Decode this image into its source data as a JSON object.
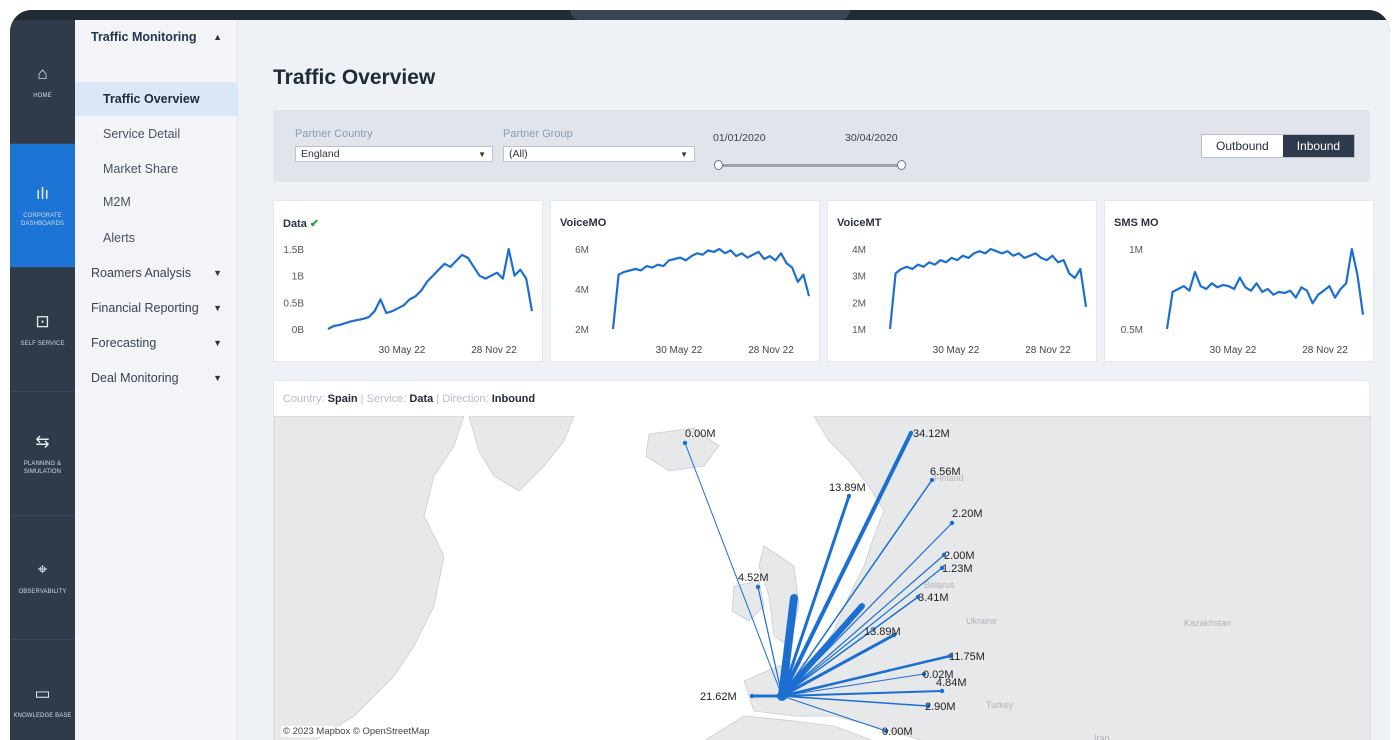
{
  "rail": [
    {
      "label": "HOME",
      "icon": "home-icon",
      "glyph": "⌂",
      "active": false
    },
    {
      "label": "CORPORATE DASHBOARDS",
      "icon": "bar-chart-icon",
      "glyph": "ılı",
      "active": true
    },
    {
      "label": "SELF SERVICE",
      "icon": "folder-icon",
      "glyph": "⊡",
      "active": false
    },
    {
      "label": "PLANNING & SIMULATION",
      "icon": "route-icon",
      "glyph": "⇆",
      "active": false
    },
    {
      "label": "OBSERVABILITY",
      "icon": "telescope-icon",
      "glyph": "⌖",
      "active": false
    },
    {
      "label": "KNOWLEDGE BASE",
      "icon": "book-icon",
      "glyph": "▭",
      "active": false
    }
  ],
  "nav": {
    "group_open": "Traffic Monitoring",
    "sub_items": [
      "Traffic Overview",
      "Service Detail",
      "Market Share",
      "M2M",
      "Alerts"
    ],
    "active_sub": "Traffic Overview",
    "groups": [
      "Roamers Analysis",
      "Financial Reporting",
      "Forecasting",
      "Deal Monitoring"
    ]
  },
  "page_title": "Traffic Overview",
  "filters": {
    "partner_country_label": "Partner Country",
    "partner_country_value": "England",
    "partner_group_label": "Partner Group",
    "partner_group_value": "(All)",
    "date_start": "01/01/2020",
    "date_end": "30/04/2020"
  },
  "direction": {
    "outbound": "Outbound",
    "inbound": "Inbound",
    "selected": "Inbound"
  },
  "check_mark": "✔",
  "accent": "#1c6fd0",
  "cards": [
    {
      "title": "Data",
      "yticks": [
        "1.5B",
        "1B",
        "0.5B",
        "0B"
      ],
      "xticks": [
        "30 May 22",
        "28 Nov 22"
      ],
      "values": [
        0.05,
        0.1,
        0.12,
        0.15,
        0.18,
        0.2,
        0.22,
        0.25,
        0.35,
        0.55,
        0.32,
        0.35,
        0.4,
        0.45,
        0.55,
        0.6,
        0.7,
        0.85,
        0.95,
        1.05,
        1.15,
        1.1,
        1.2,
        1.3,
        1.25,
        1.1,
        0.95,
        0.9,
        0.95,
        1.0,
        0.9,
        1.4,
        0.95,
        1.05,
        0.9,
        0.35
      ],
      "check": true
    },
    {
      "title": "VoiceMO",
      "yticks": [
        "6M",
        "4M",
        "2M"
      ],
      "xticks": [
        "30 May 22",
        "28 Nov 22"
      ],
      "values": [
        1.2,
        5.0,
        5.2,
        5.3,
        5.4,
        5.3,
        5.6,
        5.5,
        5.7,
        5.6,
        6.0,
        6.1,
        6.2,
        6.0,
        6.3,
        6.5,
        6.4,
        6.7,
        6.6,
        6.8,
        6.5,
        6.7,
        6.3,
        6.5,
        6.2,
        6.4,
        6.6,
        6.1,
        6.3,
        6.0,
        6.5,
        5.8,
        5.5,
        4.5,
        5.0,
        3.5
      ],
      "check": false
    },
    {
      "title": "VoiceMT",
      "yticks": [
        "4M",
        "3M",
        "2M",
        "1M"
      ],
      "xticks": [
        "30 May 22",
        "28 Nov 22"
      ],
      "values": [
        0.5,
        3.0,
        3.2,
        3.3,
        3.2,
        3.4,
        3.3,
        3.5,
        3.4,
        3.6,
        3.5,
        3.7,
        3.6,
        3.8,
        3.7,
        3.9,
        4.0,
        3.9,
        4.1,
        4.0,
        3.9,
        4.0,
        3.8,
        3.9,
        3.7,
        3.8,
        3.9,
        3.7,
        3.6,
        3.8,
        3.5,
        3.6,
        3.0,
        2.8,
        3.2,
        1.5
      ],
      "check": false
    },
    {
      "title": "SMS MO",
      "yticks": [
        "1M",
        "0.5M"
      ],
      "xticks": [
        "30 May 22",
        "28 Nov 22"
      ],
      "values": [
        0.05,
        0.7,
        0.75,
        0.8,
        0.72,
        1.05,
        0.8,
        0.75,
        0.85,
        0.78,
        0.82,
        0.8,
        0.75,
        0.95,
        0.78,
        0.72,
        0.85,
        0.7,
        0.75,
        0.65,
        0.7,
        0.68,
        0.72,
        0.6,
        0.78,
        0.72,
        0.5,
        0.65,
        0.72,
        0.8,
        0.6,
        0.75,
        0.85,
        1.45,
        1.0,
        0.3
      ],
      "check": false
    }
  ],
  "map": {
    "header": {
      "country_label": "Country:",
      "country": "Spain",
      "service_label": "Service:",
      "service": "Data",
      "direction_label": "Direction:",
      "direction": "Inbound"
    },
    "attribution": "© 2023 Mapbox © OpenStreetMap",
    "land_labels": [
      "Finland",
      "Belarus",
      "Ukraine",
      "Kazakhstan",
      "Turkey",
      "Iran"
    ],
    "flows": [
      "0.00M",
      "34.12M",
      "6.56M",
      "13.89M",
      "2.20M",
      "2.00M",
      "1.23M",
      "3.41M",
      "4.52M",
      "13.89M",
      "11.75M",
      "0.02M",
      "4.84M",
      "2.90M",
      "21.62M",
      "0.00M"
    ]
  }
}
